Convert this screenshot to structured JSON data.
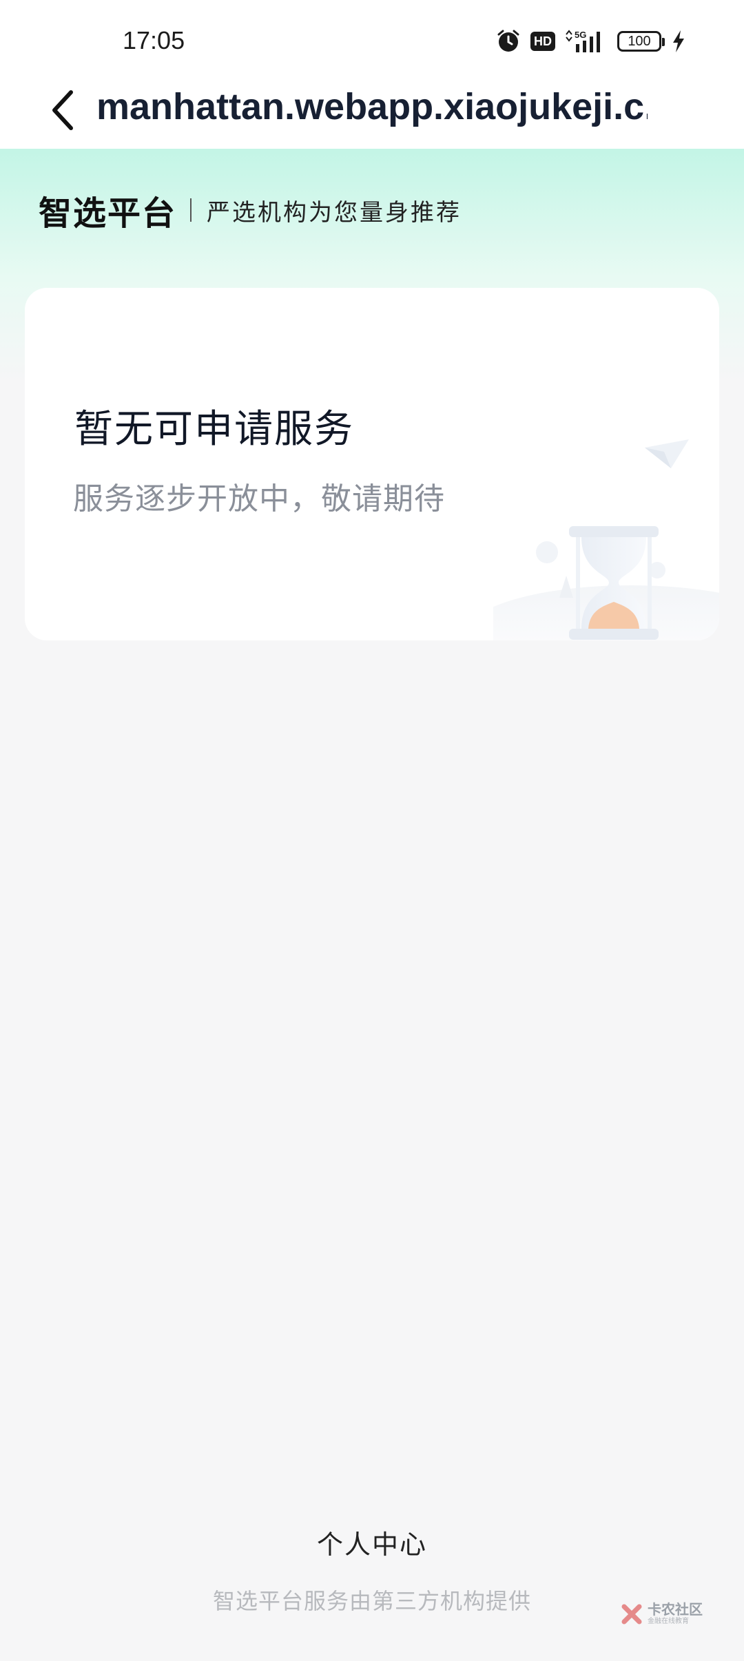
{
  "status_bar": {
    "time": "17:05",
    "hd_label": "HD",
    "network_label": "5G",
    "battery": "100",
    "icons": [
      "alarm-icon",
      "hd-icon",
      "signal-icon",
      "battery-icon",
      "charging-icon"
    ]
  },
  "nav": {
    "back_icon": "chevron-left-icon",
    "title": "manhattan.webapp.xiaojukeji.c.."
  },
  "brand": {
    "name": "智选平台",
    "slogan": "严选机构为您量身推荐"
  },
  "empty_state": {
    "title": "暂无可申请服务",
    "subtitle": "服务逐步开放中，敬请期待",
    "illustration": "hourglass-icon"
  },
  "footer": {
    "personal_center": "个人中心",
    "note": "智选平台服务由第三方机构提供"
  },
  "watermark": {
    "main": "卡农社区",
    "sub": "金融在线教育"
  },
  "colors": {
    "hero_gradient_top": "#c3f5e6",
    "page_background": "#f6f6f7",
    "card_background": "#ffffff",
    "title_text": "#111827",
    "subtitle_text": "#8a8f99",
    "footer_note_text": "#b7b9bd",
    "hourglass_sand": "#f6c9a8"
  }
}
